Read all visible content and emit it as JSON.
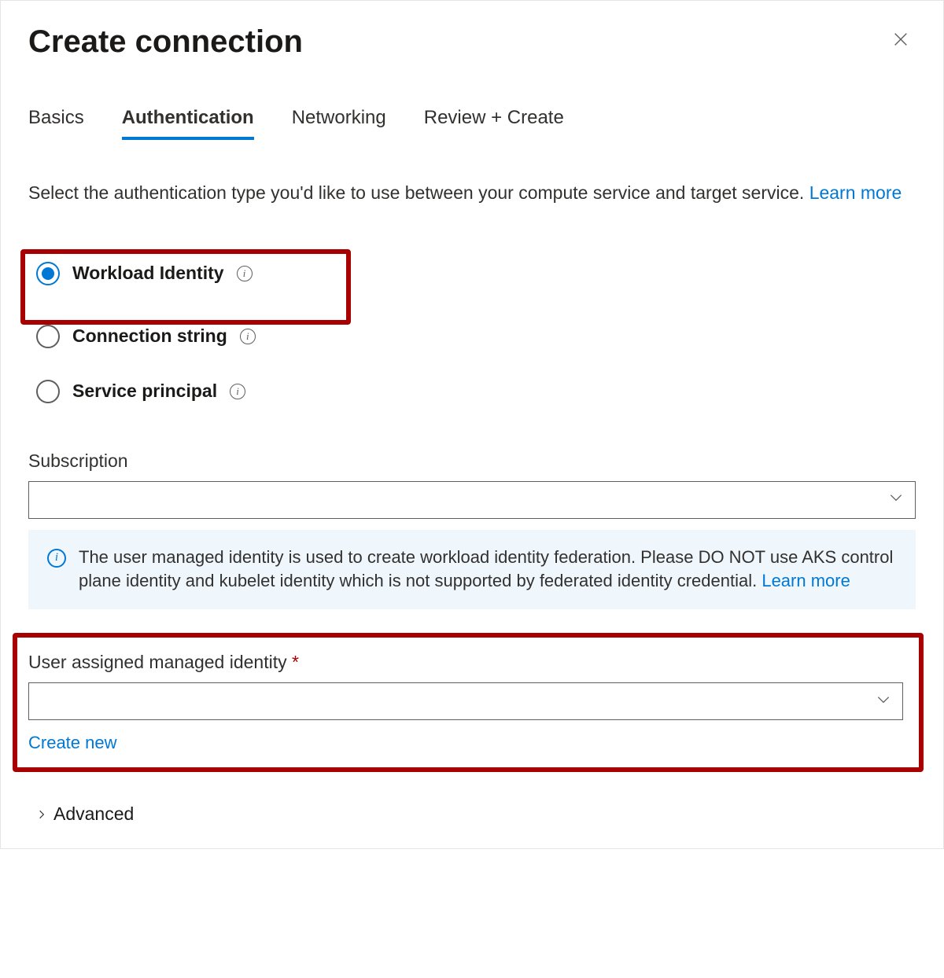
{
  "header": {
    "title": "Create connection"
  },
  "tabs": {
    "basics": "Basics",
    "authentication": "Authentication",
    "networking": "Networking",
    "review": "Review + Create"
  },
  "description": {
    "text": "Select the authentication type you'd like to use between your compute service and target service. ",
    "learn_more": "Learn more"
  },
  "auth_type": {
    "workload_identity": "Workload Identity",
    "connection_string": "Connection string",
    "service_principal": "Service principal"
  },
  "subscription": {
    "label": "Subscription",
    "value": ""
  },
  "info_box": {
    "text": "The user managed identity is used to create workload identity federation. Please DO NOT use AKS control plane identity and kubelet identity which is not supported by federated identity credential.  ",
    "learn_more": "Learn more"
  },
  "uami": {
    "label": "User assigned managed identity ",
    "required_mark": "*",
    "value": "",
    "create_new": "Create new"
  },
  "advanced": {
    "label": "Advanced"
  }
}
